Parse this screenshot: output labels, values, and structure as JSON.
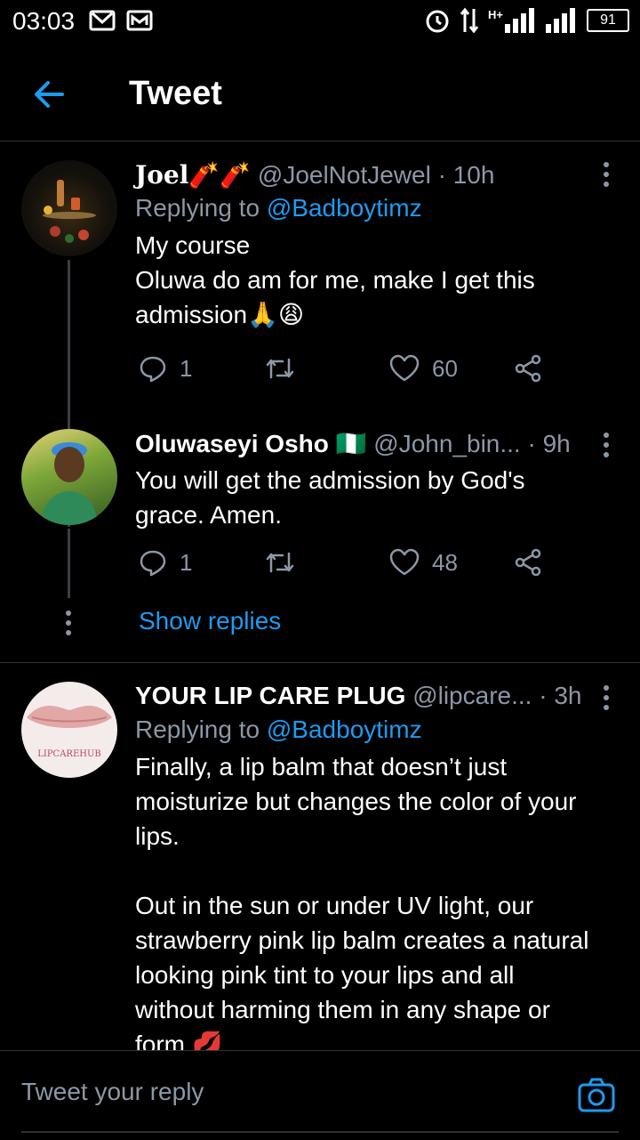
{
  "status_bar": {
    "time": "03:03",
    "network": "H+",
    "battery": "91"
  },
  "header": {
    "title": "Tweet"
  },
  "tweets": [
    {
      "name": "Joel",
      "name_emoji": "🧨🧨",
      "handle": "@JoelNotJewel",
      "time": "· 10h",
      "replying_prefix": "Replying to ",
      "replying_handle": "@Badboytimz",
      "text": "My course\nOluwa do am for me, make I get this\nadmission🙏😩",
      "replies": "1",
      "likes": "60"
    },
    {
      "name": "Oluwaseyi Osho",
      "name_emoji": "🇳🇬",
      "handle": "@John_bin...",
      "time": "· 9h",
      "text": "You will get the admission by God's\ngrace. Amen.",
      "replies": "1",
      "likes": "48"
    },
    {
      "name": "YOUR LIP CARE PLUG",
      "handle": "@lipcare...",
      "time": "· 3h",
      "replying_prefix": "Replying to ",
      "replying_handle": "@Badboytimz",
      "avatar_text": "LIPCAREHUB",
      "text": "Finally, a lip balm that doesn’t just\nmoisturize but changes the color of your\nlips.\n\nOut in the sun or under UV light, our\nstrawberry pink lip balm creates a natural\nlooking pink tint to your lips and all\nwithout harming them in any shape or\nform 💋"
    }
  ],
  "show_replies": "Show replies",
  "composer": {
    "placeholder": "Tweet your reply"
  },
  "colors": {
    "accent": "#1d9bf0",
    "muted": "#8b98a5",
    "background": "#000000"
  }
}
